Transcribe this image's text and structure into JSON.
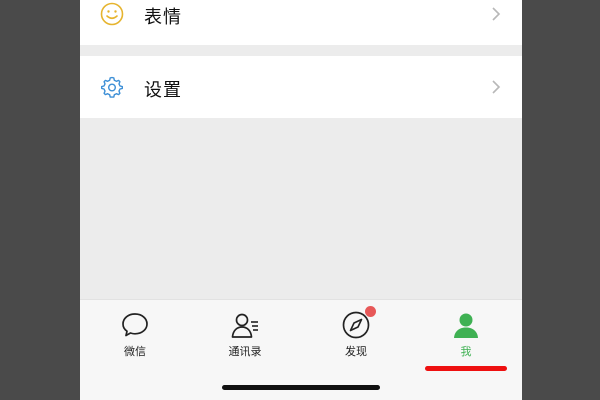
{
  "menu": {
    "emoji": {
      "label": "表情",
      "icon": "smiley-icon"
    },
    "settings": {
      "label": "设置",
      "icon": "gear-icon"
    }
  },
  "tabbar": {
    "tabs": [
      {
        "label": "微信",
        "icon": "chat-bubble-icon",
        "active": false
      },
      {
        "label": "通讯录",
        "icon": "contacts-icon",
        "active": false
      },
      {
        "label": "发现",
        "icon": "compass-icon",
        "active": false,
        "badge": true
      },
      {
        "label": "我",
        "icon": "person-icon",
        "active": true
      }
    ]
  },
  "colors": {
    "active": "#3fb153",
    "badge": "#e75858",
    "annotation_underline": "#ee1010",
    "emoji_icon": "#e6b42e",
    "settings_icon": "#3d8fd6",
    "background": "#ececec"
  }
}
